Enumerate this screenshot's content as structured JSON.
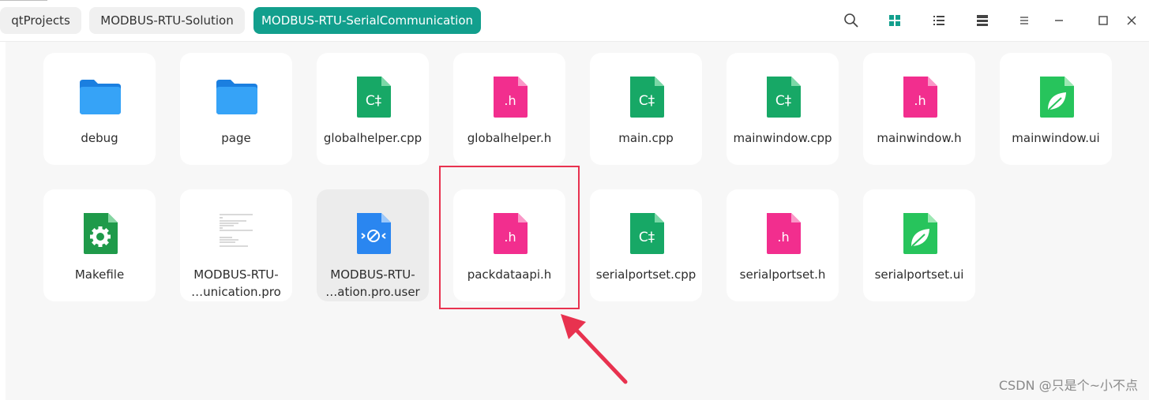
{
  "breadcrumbs": [
    {
      "label": "qtProjects",
      "active": false
    },
    {
      "label": "MODBUS-RTU-Solution",
      "active": false
    },
    {
      "label": "MODBUS-RTU-SerialCommunication",
      "active": true
    }
  ],
  "toolbar": {
    "icons": [
      "search-icon",
      "grid-view-icon",
      "list-view-icon",
      "detail-view-icon",
      "menu-icon",
      "minimize-icon",
      "maximize-icon",
      "close-icon"
    ]
  },
  "colors": {
    "accent": "#129f8d",
    "folder": "#2a8ff0",
    "cpp": "#17a866",
    "header": "#f22e8e",
    "ui": "#27c45c",
    "annotation": "#e8324f"
  },
  "files": [
    {
      "name": "debug",
      "type": "folder"
    },
    {
      "name": "page",
      "type": "folder"
    },
    {
      "name": "globalhelper.cpp",
      "type": "cpp",
      "icon_text": "C‡"
    },
    {
      "name": "globalhelper.h",
      "type": "header",
      "icon_text": ".h"
    },
    {
      "name": "main.cpp",
      "type": "cpp",
      "icon_text": "C‡"
    },
    {
      "name": "mainwindow.cpp",
      "type": "cpp",
      "icon_text": "C‡"
    },
    {
      "name": "mainwindow.h",
      "type": "header",
      "icon_text": ".h"
    },
    {
      "name": "mainwindow.ui",
      "type": "ui"
    },
    {
      "name": "Makefile",
      "type": "makefile"
    },
    {
      "name": "MODBUS-RTU-\n…unication.pro",
      "type": "pro"
    },
    {
      "name": "MODBUS-RTU-\n…ation.pro.user",
      "type": "user",
      "selected": true
    },
    {
      "name": "packdataapi.h",
      "type": "header",
      "icon_text": ".h"
    },
    {
      "name": "serialportset.cpp",
      "type": "cpp",
      "icon_text": "C‡"
    },
    {
      "name": "serialportset.h",
      "type": "header",
      "icon_text": ".h"
    },
    {
      "name": "serialportset.ui",
      "type": "ui"
    }
  ],
  "watermark": "CSDN @只是个~小不点"
}
